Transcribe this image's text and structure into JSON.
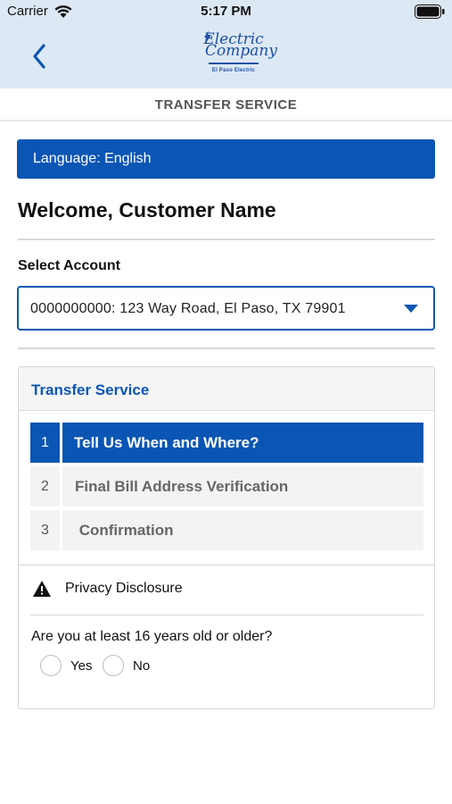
{
  "status_bar": {
    "carrier": "Carrier",
    "time": "5:17 PM"
  },
  "header": {
    "logo_line1": "Electric",
    "logo_line2": "Company",
    "logo_sub": "El Paso Electric",
    "subtitle": "TRANSFER SERVICE"
  },
  "language_bar": {
    "label": "Language: English"
  },
  "welcome": "Welcome, Customer Name",
  "account": {
    "label": "Select Account",
    "selected": "0000000000: 123 Way Road, El Paso, TX 79901"
  },
  "card": {
    "title": "Transfer Service",
    "steps": [
      {
        "number": "1",
        "label": "Tell Us When and Where?"
      },
      {
        "number": "2",
        "label": "Final Bill Address Verification"
      },
      {
        "number": "3",
        "label": " Confirmation"
      }
    ],
    "privacy_label": "Privacy Disclosure",
    "question": "Are you at least 16 years old or older?",
    "options": [
      "Yes",
      "No"
    ]
  },
  "colors": {
    "brand": "#0b56b4",
    "header_bg": "#dde8f5"
  }
}
